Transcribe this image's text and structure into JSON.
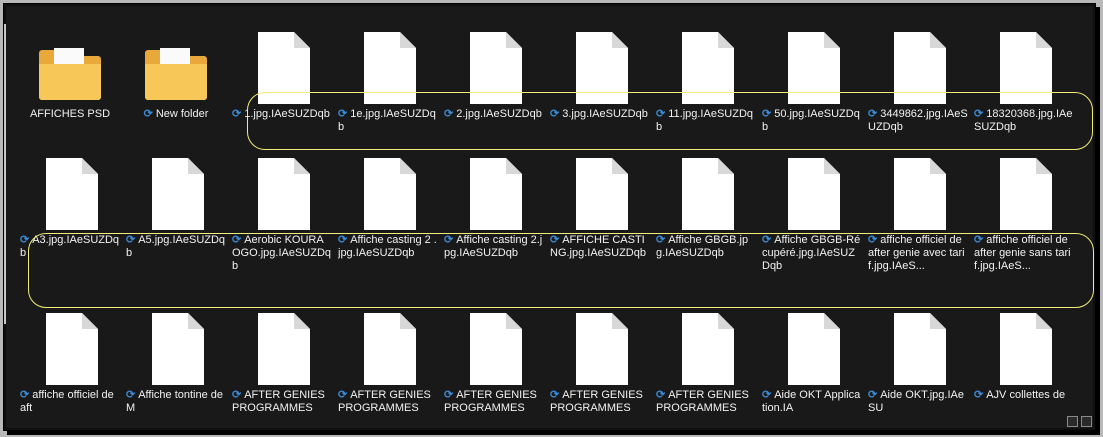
{
  "sync_icon": "sync-arrows-icon",
  "colors": {
    "background": "#191919",
    "highlight": "#f2ec78",
    "sync": "#3b8ad6",
    "text": "#f2f2f2",
    "folder": "#f5c04a",
    "file": "#ffffff"
  },
  "rows": [
    {
      "items": [
        {
          "type": "folder",
          "label": "AFFICHES PSD",
          "sync": false
        },
        {
          "type": "folder",
          "label": "New folder",
          "sync": true
        },
        {
          "type": "file",
          "label": "1.jpg.IAeSUZDqb",
          "sync": true
        },
        {
          "type": "file",
          "label": "1e.jpg.IAeSUZDqb",
          "sync": true
        },
        {
          "type": "file",
          "label": "2.jpg.IAeSUZDqb",
          "sync": true
        },
        {
          "type": "file",
          "label": "3.jpg.IAeSUZDqb",
          "sync": true
        },
        {
          "type": "file",
          "label": "11.jpg.IAeSUZDqb",
          "sync": true
        },
        {
          "type": "file",
          "label": "50.jpg.IAeSUZDqb",
          "sync": true
        },
        {
          "type": "file",
          "label": "3449862.jpg.IAeSUZDqb",
          "sync": true
        },
        {
          "type": "file",
          "label": "18320368.jpg.IAeSUZDqb",
          "sync": true
        }
      ]
    },
    {
      "items": [
        {
          "type": "file",
          "label": "A3.jpg.IAeSUZDqb",
          "sync": true
        },
        {
          "type": "file",
          "label": "A5.jpg.IAeSUZDqb",
          "sync": true
        },
        {
          "type": "file",
          "label": "Aerobic KOURAOGO.jpg.IAeSUZDqb",
          "sync": true
        },
        {
          "type": "file",
          "label": "Affiche casting 2 .jpg.IAeSUZDqb",
          "sync": true
        },
        {
          "type": "file",
          "label": "Affiche casting 2.jpg.IAeSUZDqb",
          "sync": true
        },
        {
          "type": "file",
          "label": "AFFICHE CASTING.jpg.IAeSUZDqb",
          "sync": true
        },
        {
          "type": "file",
          "label": "Affiche GBGB.jpg.IAeSUZDqb",
          "sync": true
        },
        {
          "type": "file",
          "label": "Affiche GBGB-Récupéré.jpg.IAeSUZDqb",
          "sync": true
        },
        {
          "type": "file",
          "label": "affiche officiel de after genie avec tarif.jpg.IAeS...",
          "sync": true
        },
        {
          "type": "file",
          "label": "affiche officiel de after genie sans tarif.jpg.IAeS...",
          "sync": true
        }
      ]
    },
    {
      "items": [
        {
          "type": "file",
          "label": "affiche officiel de aft",
          "sync": true
        },
        {
          "type": "file",
          "label": "Affiche tontine de M",
          "sync": true
        },
        {
          "type": "file",
          "label": "AFTER GENIES PROGRAMMES",
          "sync": true
        },
        {
          "type": "file",
          "label": "AFTER GENIES PROGRAMMES",
          "sync": true
        },
        {
          "type": "file",
          "label": "AFTER GENIES PROGRAMMES",
          "sync": true
        },
        {
          "type": "file",
          "label": "AFTER GENIES PROGRAMMES",
          "sync": true
        },
        {
          "type": "file",
          "label": "AFTER GENIES PROGRAMMES",
          "sync": true
        },
        {
          "type": "file",
          "label": "Aide OKT Application.IA",
          "sync": true
        },
        {
          "type": "file",
          "label": "Aide OKT.jpg.IAeSU",
          "sync": true
        },
        {
          "type": "file",
          "label": "AJV collettes de",
          "sync": true
        }
      ]
    }
  ]
}
